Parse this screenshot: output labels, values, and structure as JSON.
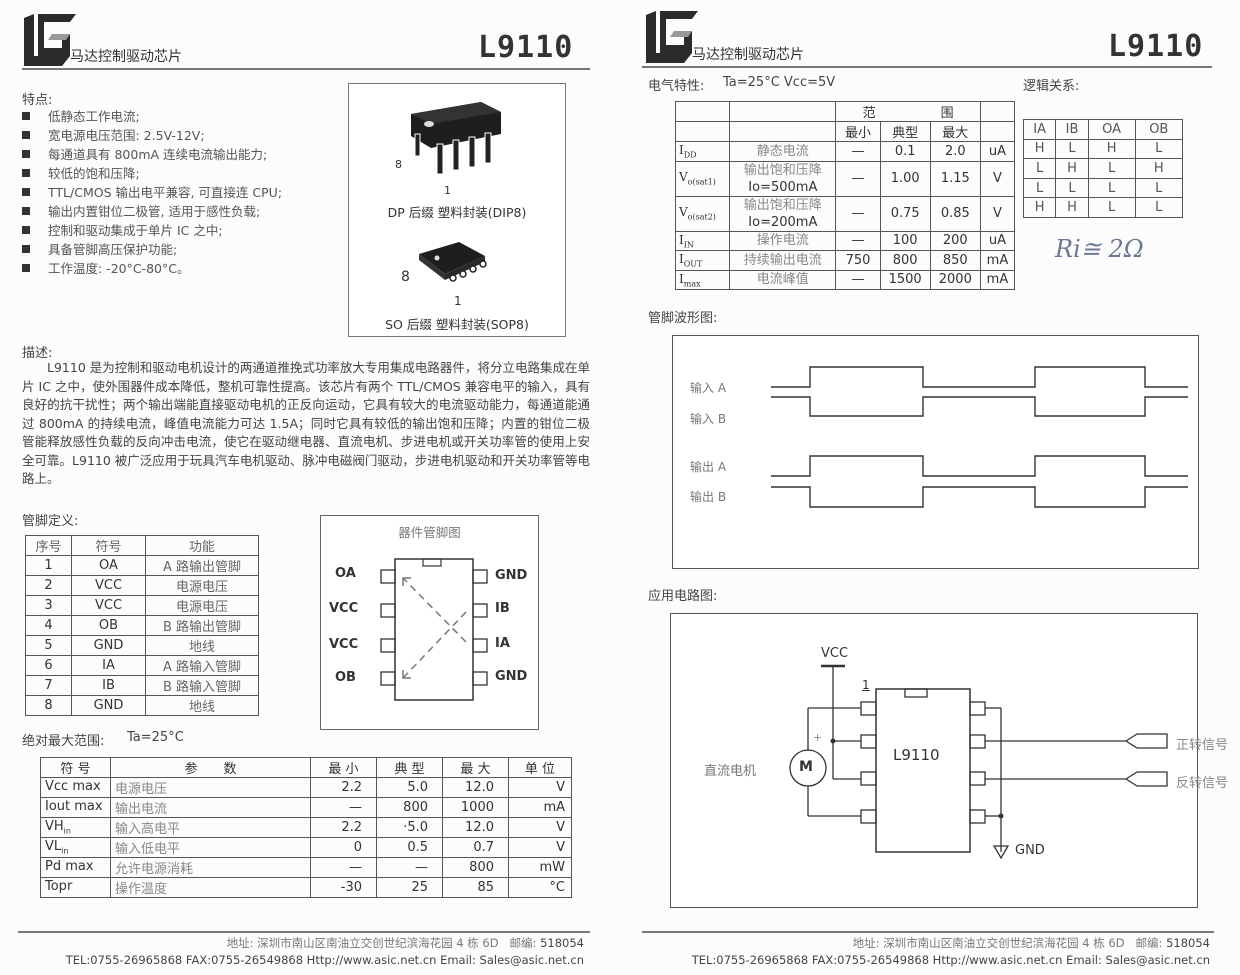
{
  "header": {
    "brand_subtitle": "马达控制驱动芯片",
    "part_number": "L9110",
    "logo_icon": "lg-company-logo"
  },
  "left_page": {
    "features": {
      "title": "特点:",
      "items": [
        "低静态工作电流;",
        "宽电源电压范围: 2.5V-12V;",
        "每通道具有 800mA 连续电流输出能力;",
        "较低的饱和压降;",
        "TTL/CMOS 输出电平兼容, 可直接连 CPU;",
        "输出内置钳位二极管, 适用于感性负载;",
        "控制和驱动集成于单片 IC 之中;",
        "具备管脚高压保护功能;",
        "工作温度: -20°C-80°C。"
      ]
    },
    "packages": {
      "dip_pin8_label": "8",
      "dip_pin1_label": "1",
      "dip_caption": "DP 后缀 塑料封装(DIP8)",
      "sop_pin8_label": "8",
      "sop_pin1_label": "1",
      "sop_caption": "SO 后缀 塑料封装(SOP8)"
    },
    "description": {
      "title": "描述:",
      "text": "L9110 是为控制和驱动电机设计的两通道推挽式功率放大专用集成电路器件，将分立电路集成在单片 IC 之中，使外围器件成本降低，整机可靠性提高。该芯片有两个 TTL/CMOS 兼容电平的输入，具有良好的抗干扰性；两个输出端能直接驱动电机的正反向运动，它具有较大的电流驱动能力，每通道能通过 800mA 的持续电流，峰值电流能力可达 1.5A；同时它具有较低的输出饱和压降；内置的钳位二极管能释放感性负载的反向冲击电流，使它在驱动继电器、直流电机、步进电机或开关功率管的使用上安全可靠。L9110 被广泛应用于玩具汽车电机驱动、脉冲电磁阀门驱动，步进电机驱动和开关功率管等电路上。"
    },
    "pin_definition": {
      "title": "管脚定义:",
      "headers": [
        "序号",
        "符号",
        "功能"
      ],
      "rows": [
        [
          "1",
          "OA",
          "A 路输出管脚"
        ],
        [
          "2",
          "VCC",
          "电源电压"
        ],
        [
          "3",
          "VCC",
          "电源电压"
        ],
        [
          "4",
          "OB",
          "B 路输出管脚"
        ],
        [
          "5",
          "GND",
          "地线"
        ],
        [
          "6",
          "IA",
          "A 路输入管脚"
        ],
        [
          "7",
          "IB",
          "B 路输入管脚"
        ],
        [
          "8",
          "GND",
          "地线"
        ]
      ]
    },
    "pinout_diagram": {
      "title": "器件管脚图",
      "left_pins": [
        "OA",
        "VCC",
        "VCC",
        "OB"
      ],
      "right_pins": [
        "GND",
        "IB",
        "IA",
        "GND"
      ]
    },
    "absolute_max": {
      "title": "绝对最大范围:",
      "condition": "Ta=25°C",
      "headers": [
        "符 号",
        "参　　数",
        "最 小",
        "典 型",
        "最 大",
        "单 位"
      ],
      "rows": [
        {
          "sym": "Vcc max",
          "sub": "",
          "param": "电源电压",
          "min": "2.2",
          "typ": "5.0",
          "max": "12.0",
          "unit": "V"
        },
        {
          "sym": "Iout max",
          "sub": "",
          "param": "输出电流",
          "min": "—",
          "typ": "800",
          "max": "1000",
          "unit": "mA"
        },
        {
          "sym": "VH",
          "sub": "in",
          "param": "输入高电平",
          "min": "2.2",
          "typ": "·5.0",
          "max": "12.0",
          "unit": "V"
        },
        {
          "sym": "VL",
          "sub": "in",
          "param": "输入低电平",
          "min": "0",
          "typ": "0.5",
          "max": "0.7",
          "unit": "V"
        },
        {
          "sym": "Pd max",
          "sub": "",
          "param": "允许电源消耗",
          "min": "—",
          "typ": "—",
          "max": "800",
          "unit": "mW"
        },
        {
          "sym": "Topr",
          "sub": "",
          "param": "操作温度",
          "min": "-30",
          "typ": "25",
          "max": "85",
          "unit": "°C"
        }
      ]
    },
    "footer": {
      "address_label": "地址:",
      "address": "深圳市南山区南油立交创世纪滨海花园 4 栋 6D",
      "postcode_label": "邮编:",
      "postcode": "518054",
      "contact": "TEL:0755-26965868  FAX:0755-26549868  Http://www.asic.net.cn   Email: Sales@asic.net.cn"
    }
  },
  "right_page": {
    "electrical": {
      "title": "电气特性:",
      "condition": "Ta=25°C Vcc=5V",
      "range_header_left": "范",
      "range_header_right": "围",
      "subheaders": [
        "最小",
        "典型",
        "最大"
      ],
      "rows": [
        {
          "sym": "I",
          "sub": "DD",
          "param": "静态电流",
          "param2": "",
          "min": "—",
          "typ": "0.1",
          "max": "2.0",
          "unit": "uA"
        },
        {
          "sym": "V",
          "sub": "o(sat1)",
          "param": "输出饱和压降",
          "param2": "Io=500mA",
          "min": "—",
          "typ": "1.00",
          "max": "1.15",
          "unit": "V"
        },
        {
          "sym": "V",
          "sub": "o(sat2)",
          "param": "输出饱和压降",
          "param2": "Io=200mA",
          "min": "—",
          "typ": "0.75",
          "max": "0.85",
          "unit": "V"
        },
        {
          "sym": "I",
          "sub": "IN",
          "param": "操作电流",
          "param2": "",
          "min": "—",
          "typ": "100",
          "max": "200",
          "unit": "uA"
        },
        {
          "sym": "I",
          "sub": "OUT",
          "param": "持续输出电流",
          "param2": "",
          "min": "750",
          "typ": "800",
          "max": "850",
          "unit": "mA"
        },
        {
          "sym": "I",
          "sub": "max",
          "param": "电流峰值",
          "param2": "",
          "min": "—",
          "typ": "1500",
          "max": "2000",
          "unit": "mA"
        }
      ]
    },
    "logic": {
      "title": "逻辑关系:",
      "headers": [
        "IA",
        "IB",
        "OA",
        "OB"
      ],
      "rows": [
        [
          "H",
          "L",
          "H",
          "L"
        ],
        [
          "L",
          "H",
          "L",
          "H"
        ],
        [
          "L",
          "L",
          "L",
          "L"
        ],
        [
          "H",
          "H",
          "L",
          "L"
        ]
      ],
      "handwritten_note": "Ri≅ 2Ω"
    },
    "waveform": {
      "title": "管脚波形图:",
      "signals": [
        {
          "label": "输入 A",
          "levels": [
            0,
            1,
            0,
            1,
            0
          ]
        },
        {
          "label": "输入 B",
          "levels": [
            1,
            0,
            1,
            0,
            1
          ]
        },
        {
          "label": "输出 A",
          "levels": [
            0,
            1,
            0,
            1,
            0
          ]
        },
        {
          "label": "输出 B",
          "levels": [
            1,
            0,
            1,
            0,
            1
          ]
        }
      ]
    },
    "application": {
      "title": "应用电路图:",
      "vcc_label": "VCC",
      "pin1_marker": "1",
      "chip_label": "L9110",
      "motor_label": "直流电机",
      "motor_symbol": "M",
      "motor_plus": "+",
      "forward_signal": "正转信号",
      "reverse_signal": "反转信号",
      "gnd_label": "GND"
    },
    "footer": {
      "address_label": "地址:",
      "address": "深圳市南山区南油立交创世纪滨海花园 4 栋 6D",
      "postcode_label": "邮编:",
      "postcode": "518054",
      "contact": "TEL:0755-26965868  FAX:0755-26549868  Http://www.asic.net.cn   Email: Sales@asic.net.cn"
    }
  }
}
